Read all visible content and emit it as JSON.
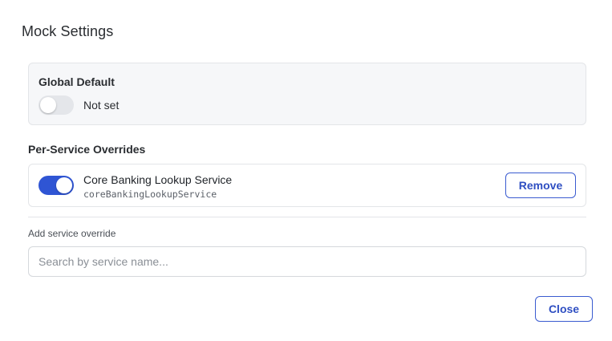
{
  "dialog": {
    "title": "Mock Settings"
  },
  "global_default": {
    "label": "Global Default",
    "enabled": false,
    "status_text": "Not set"
  },
  "overrides": {
    "section_label": "Per-Service Overrides",
    "items": [
      {
        "name": "Core Banking Lookup Service",
        "id": "coreBankingLookupService",
        "enabled": true,
        "remove_label": "Remove"
      }
    ]
  },
  "add_override": {
    "label": "Add service override",
    "placeholder": "Search by service name...",
    "value": ""
  },
  "footer": {
    "close_label": "Close"
  },
  "colors": {
    "accent": "#2f55d4",
    "toggle_off": "#e4e6ea",
    "panel_bg": "#f6f7f9",
    "border": "#e3e5e8"
  }
}
